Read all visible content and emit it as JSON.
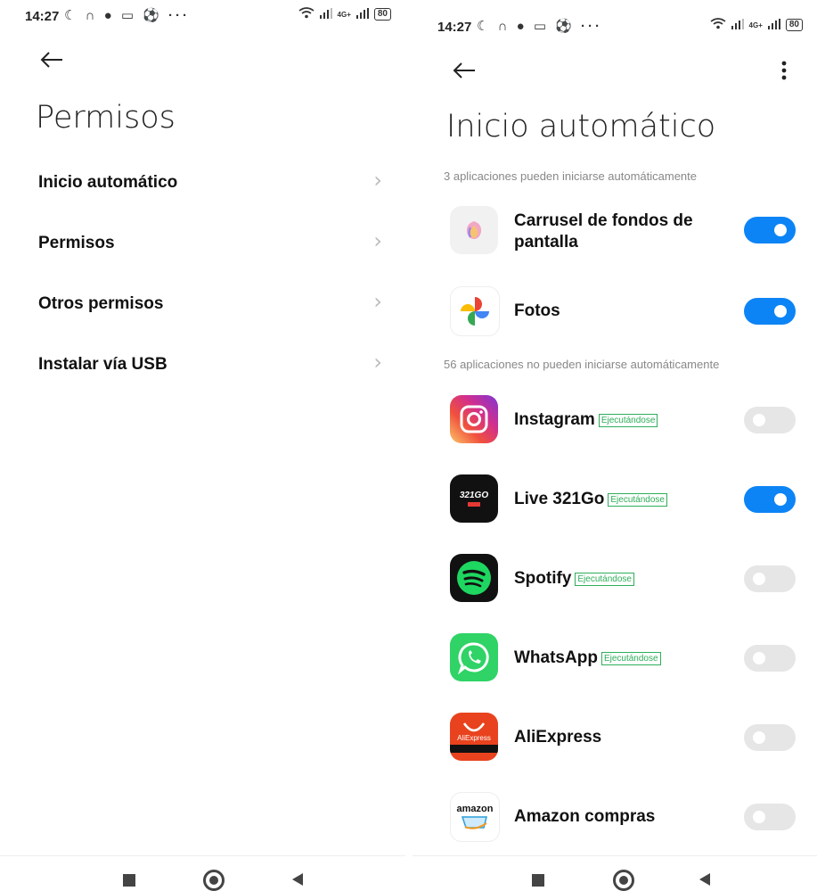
{
  "left": {
    "status": {
      "time": "14:27",
      "icons_left": "☾ ∩ ● ▭ ⚽ ···",
      "network": "4G+",
      "battery": "80"
    },
    "title": "Permisos",
    "menu": [
      {
        "label": "Inicio automático"
      },
      {
        "label": "Permisos"
      },
      {
        "label": "Otros permisos"
      },
      {
        "label": "Instalar vía USB"
      }
    ]
  },
  "right": {
    "status": {
      "time": "14:27",
      "icons_left": "☾ ∩ ● ▭ ⚽ ···",
      "network": "4G+",
      "battery": "80"
    },
    "title": "Inicio automático",
    "section_enabled": "3 aplicaciones pueden iniciarse automáticamente",
    "section_disabled": "56 aplicaciones no pueden iniciarse automáticamente",
    "apps": [
      {
        "name": "Carrusel de fondos de pantalla",
        "icon": "wallpaper-carousel-icon",
        "tag": "",
        "enabled": true
      },
      {
        "name": "Fotos",
        "icon": "google-photos-icon",
        "tag": "",
        "enabled": true
      },
      {
        "name": "Instagram",
        "icon": "instagram-icon",
        "tag": "Ejecutándose",
        "enabled": false
      },
      {
        "name": "Live 321Go",
        "icon": "live321go-icon",
        "tag": "Ejecutándose",
        "enabled": true
      },
      {
        "name": "Spotify",
        "icon": "spotify-icon",
        "tag": "Ejecutándose",
        "enabled": false
      },
      {
        "name": "WhatsApp",
        "icon": "whatsapp-icon",
        "tag": "Ejecutándose",
        "enabled": false
      },
      {
        "name": "AliExpress",
        "icon": "aliexpress-icon",
        "tag": "",
        "enabled": false
      },
      {
        "name": "Amazon compras",
        "icon": "amazon-icon",
        "tag": "",
        "enabled": false
      }
    ],
    "icon_text": {
      "live": "321GO",
      "aliexpress": "AliExpress",
      "amazon": "amazon"
    }
  },
  "colors": {
    "accent": "#0d84f5",
    "running_tag": "#2fae5a",
    "toggle_off": "#e6e6e6"
  }
}
